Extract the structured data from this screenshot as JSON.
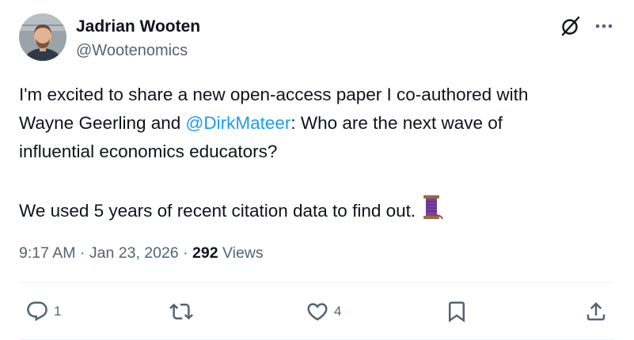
{
  "author": {
    "name": "Jadrian Wooten",
    "handle": "@Wootenomics"
  },
  "header_icons": [
    "grok-icon",
    "more-icon"
  ],
  "tweet": {
    "line1": "I'm excited to share a new open-access paper I co-authored with",
    "line2_prefix": "Wayne Geerling and ",
    "mention": "@DirkMateer",
    "line2_suffix": ": Who are the next wave of",
    "line3": "influential economics educators?",
    "line4": "We used 5 years of recent citation data to find out.",
    "emoji": "thread-icon"
  },
  "meta": {
    "time": "9:17 AM",
    "sep1": " · ",
    "date": "Jan 23, 2026",
    "sep2": " · ",
    "views_count": "292",
    "views_label": " Views"
  },
  "actions": {
    "reply": {
      "icon": "reply-icon",
      "count": "1"
    },
    "repost": {
      "icon": "repost-icon",
      "count": ""
    },
    "like": {
      "icon": "like-icon",
      "count": "4"
    },
    "bookmark": {
      "icon": "bookmark-icon",
      "count": ""
    },
    "share": {
      "icon": "share-icon",
      "count": ""
    }
  },
  "colors": {
    "text": "#0f1419",
    "secondary": "#536471",
    "link": "#1d9bf0",
    "divider": "#eff3f4",
    "thread_emoji": "#7b3fa0"
  }
}
